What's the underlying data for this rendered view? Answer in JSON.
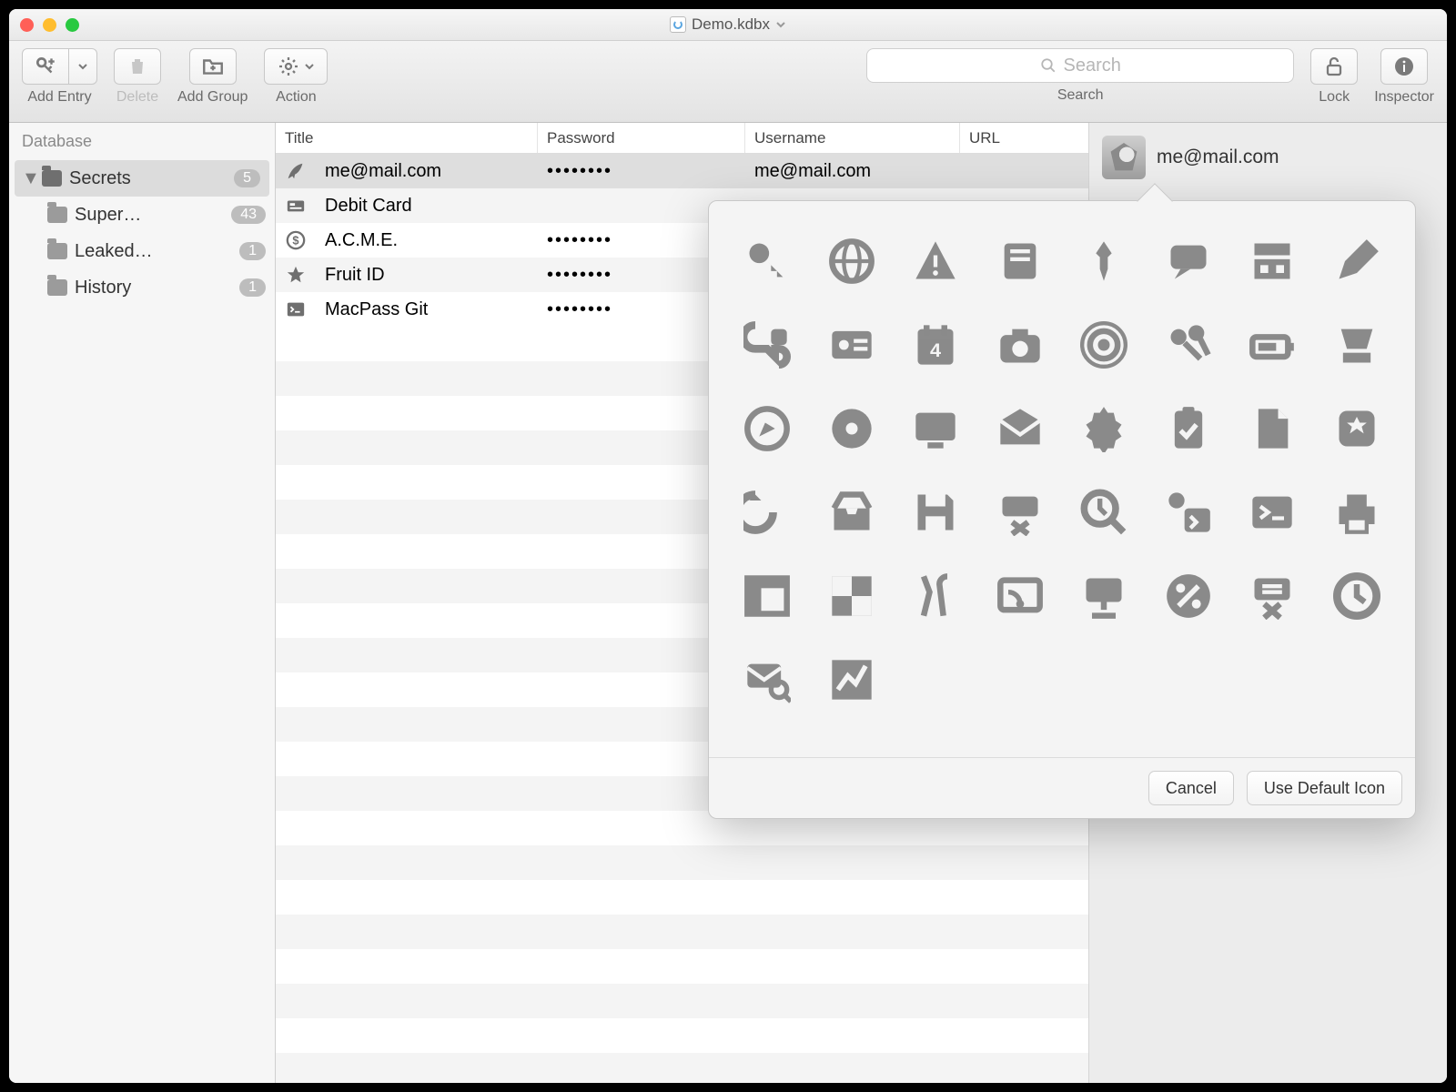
{
  "window": {
    "title": "Demo.kdbx"
  },
  "toolbar": {
    "add_entry": "Add Entry",
    "delete": "Delete",
    "add_group": "Add Group",
    "action": "Action",
    "search": {
      "label": "Search",
      "placeholder": "Search"
    },
    "lock": "Lock",
    "inspector": "Inspector"
  },
  "sidebar": {
    "header": "Database",
    "items": [
      {
        "name": "Secrets",
        "count": "5",
        "selected": true,
        "expanded": true
      },
      {
        "name": "Super…",
        "count": "43",
        "child": true
      },
      {
        "name": "Leaked…",
        "count": "1",
        "child": true
      },
      {
        "name": "History",
        "count": "1",
        "child": true
      }
    ]
  },
  "columns": {
    "title": "Title",
    "password": "Password",
    "username": "Username",
    "url": "URL"
  },
  "entries": [
    {
      "icon": "feather",
      "title": "me@mail.com",
      "password": "••••••••",
      "username": "me@mail.com",
      "selected": true
    },
    {
      "icon": "idcard",
      "title": "Debit Card",
      "password": "",
      "username": ""
    },
    {
      "icon": "dollar",
      "title": "A.C.M.E.",
      "password": "••••••••",
      "username": ""
    },
    {
      "icon": "star",
      "title": "Fruit ID",
      "password": "••••••••",
      "username": ""
    },
    {
      "icon": "terminal",
      "title": "MacPass Git",
      "password": "••••••••",
      "username": ""
    }
  ],
  "inspector_panel": {
    "title": "me@mail.com"
  },
  "popover": {
    "cancel": "Cancel",
    "default": "Use Default Icon",
    "icons": [
      "key",
      "globe",
      "warning",
      "server",
      "pin",
      "chat",
      "apartment",
      "pencil",
      "plug",
      "idcard",
      "calendar",
      "camera",
      "broadcast",
      "keys",
      "battery",
      "scanner",
      "compass",
      "disc",
      "monitor",
      "mail",
      "gear",
      "clipboard",
      "document",
      "app-star",
      "swap",
      "inbox",
      "save",
      "drive-x",
      "clock-search",
      "key-terminal",
      "terminal",
      "printer",
      "layout",
      "contrast",
      "tools",
      "dashboard",
      "monitor-stand",
      "percent",
      "drive-fail",
      "clock",
      "mail-search",
      "chart"
    ]
  }
}
